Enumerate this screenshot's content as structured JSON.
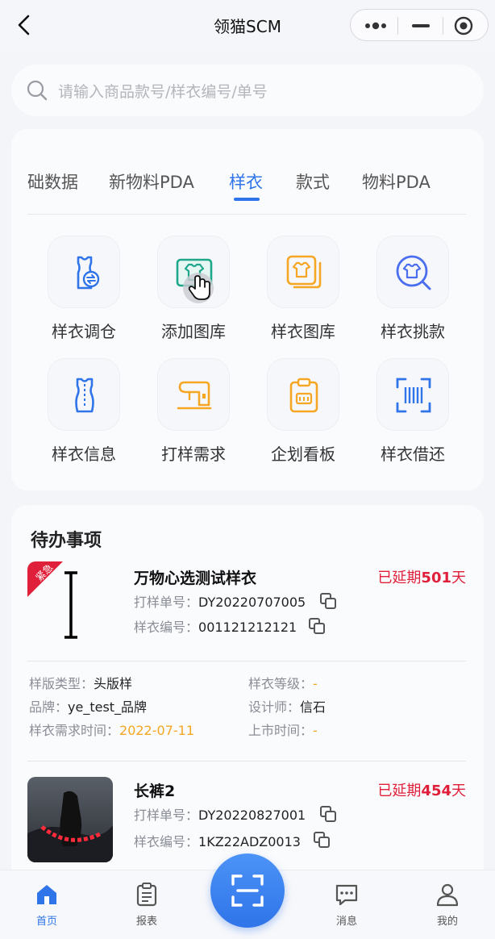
{
  "nav": {
    "title": "领猫SCM"
  },
  "search": {
    "placeholder": "请输入商品款号/样衣编号/单号"
  },
  "tabs": [
    {
      "label": "础数据"
    },
    {
      "label": "新物料PDA"
    },
    {
      "label": "样衣"
    },
    {
      "label": "款式"
    },
    {
      "label": "物料PDA"
    }
  ],
  "grid": [
    {
      "label": "样衣调仓",
      "icon": "garment-transfer-icon"
    },
    {
      "label": "添加图库",
      "icon": "add-gallery-icon"
    },
    {
      "label": "样衣图库",
      "icon": "garment-gallery-icon"
    },
    {
      "label": "样衣挑款",
      "icon": "garment-search-icon"
    },
    {
      "label": "样衣信息",
      "icon": "garment-info-icon"
    },
    {
      "label": "打样需求",
      "icon": "sewing-machine-icon"
    },
    {
      "label": "企划看板",
      "icon": "clipboard-icon"
    },
    {
      "label": "样衣借还",
      "icon": "scan-code-icon"
    }
  ],
  "todo": {
    "heading": "待办事项",
    "items": [
      {
        "title": "万物心选测试样衣",
        "overdue_prefix": "已延期",
        "overdue_days": "501",
        "overdue_suffix": "天",
        "order_label": "打样单号：",
        "order_no": "DY20220707005",
        "code_label": "样衣编号：",
        "code_no": "001121212121",
        "badge": "紧急",
        "pattern_type_label": "样版类型：",
        "pattern_type": "头版样",
        "grade_label": "样衣等级：",
        "grade": "-",
        "brand_label": "品牌：",
        "brand": "ye_test_品牌",
        "designer_label": "设计师：",
        "designer": "信石",
        "demand_time_label": "样衣需求时间：",
        "demand_time": "2022-07-11",
        "launch_time_label": "上市时间：",
        "launch_time": "-"
      },
      {
        "title": "长裤2",
        "overdue_prefix": "已延期",
        "overdue_days": "454",
        "overdue_suffix": "天",
        "order_label": "打样单号：",
        "order_no": "DY20220827001",
        "code_label": "样衣编号：",
        "code_no": "1KZ22ADZ0013"
      }
    ]
  },
  "tabbar": [
    {
      "label": "首页"
    },
    {
      "label": "报表"
    },
    {
      "label": "消息"
    },
    {
      "label": "我的"
    }
  ],
  "colors": {
    "accent": "#2f74e9",
    "danger": "#e0203a",
    "warning": "#f5a623"
  }
}
